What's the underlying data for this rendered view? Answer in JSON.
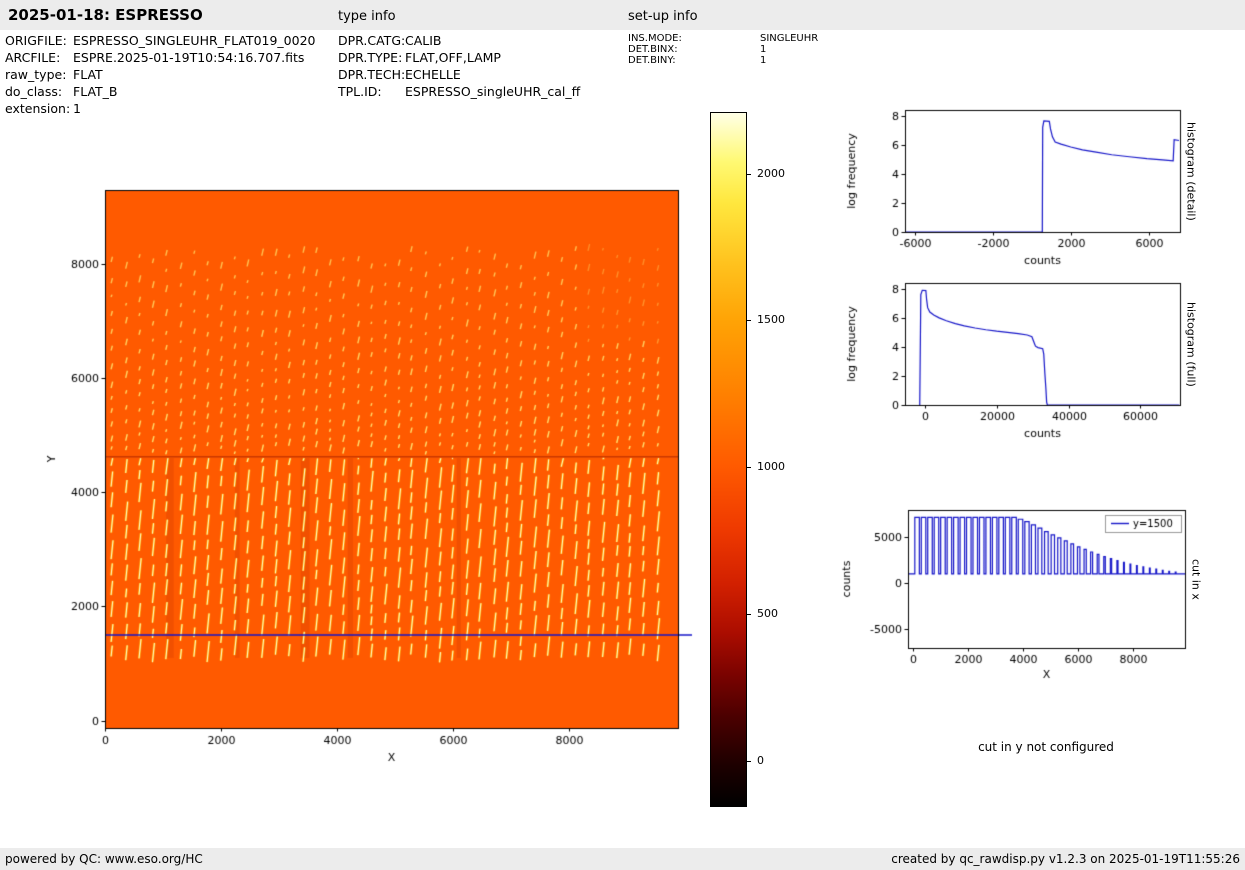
{
  "header": {
    "title": "2025-01-18: ESPRESSO",
    "type_info_label": "type info",
    "setup_info_label": "set-up info"
  },
  "metadata": {
    "left": [
      {
        "label": "ORIGFILE:",
        "value": "ESPRESSO_SINGLEUHR_FLAT019_0020"
      },
      {
        "label": "ARCFILE:",
        "value": "ESPRE.2025-01-19T10:54:16.707.fits"
      },
      {
        "label": "raw_type:",
        "value": "FLAT"
      },
      {
        "label": "do_class:",
        "value": "FLAT_B"
      },
      {
        "label": "extension:",
        "value": "1"
      }
    ],
    "type": [
      {
        "label": "DPR.CATG:",
        "value": "CALIB"
      },
      {
        "label": "DPR.TYPE:",
        "value": "FLAT,OFF,LAMP"
      },
      {
        "label": "DPR.TECH:",
        "value": "ECHELLE"
      },
      {
        "label": "TPL.ID:",
        "value": "ESPRESSO_singleUHR_cal_ff"
      }
    ],
    "setup": [
      {
        "label": "INS.MODE:",
        "value": "SINGLEUHR"
      },
      {
        "label": "DET.BINX:",
        "value": "1"
      },
      {
        "label": "DET.BINY:",
        "value": "1"
      }
    ]
  },
  "colors": {
    "accent_blue": "#1414c8",
    "header_bg": "#ececec",
    "image_base": "#ff5a00"
  },
  "colorbar": {
    "vmin": -150,
    "vmax": 2210,
    "tick_values": [
      2000,
      1500,
      1000,
      500,
      0
    ],
    "stops": [
      {
        "p": 0,
        "c": "#ffffe6"
      },
      {
        "p": 7,
        "c": "#fff973"
      },
      {
        "p": 13,
        "c": "#ffe73e"
      },
      {
        "p": 22,
        "c": "#ffc11d"
      },
      {
        "p": 30,
        "c": "#ffa305"
      },
      {
        "p": 41,
        "c": "#ff7f00"
      },
      {
        "p": 51,
        "c": "#ff5a00"
      },
      {
        "p": 60,
        "c": "#ef3a00"
      },
      {
        "p": 68,
        "c": "#d22000"
      },
      {
        "p": 75,
        "c": "#ab0d00"
      },
      {
        "p": 81,
        "c": "#7b0300"
      },
      {
        "p": 87,
        "c": "#4c0000"
      },
      {
        "p": 94,
        "c": "#1e0000"
      },
      {
        "p": 100,
        "c": "#000000"
      }
    ]
  },
  "chart_data": [
    {
      "id": "raw_image",
      "type": "heatmap",
      "xlabel": "X",
      "ylabel": "Y",
      "xlim": [
        0,
        9880
      ],
      "ylim": [
        -130,
        9300
      ],
      "xticks": [
        0,
        2000,
        4000,
        6000,
        8000
      ],
      "yticks": [
        0,
        2000,
        4000,
        6000,
        8000
      ],
      "background_counts": 1000,
      "cut_line_y": 1500,
      "orders": {
        "n_columns": 41,
        "x_start": 115,
        "spacing": 235,
        "bright_y_range": [
          1020,
          4600
        ],
        "faint_y_range": [
          4660,
          8260
        ],
        "gap_y": 4625
      },
      "dark_bands": [
        {
          "x": 1120,
          "w": 130
        },
        {
          "x": 2280,
          "w": 80
        },
        {
          "x": 3450,
          "w": 150
        },
        {
          "x": 4230,
          "w": 90
        },
        {
          "x": 6100,
          "w": 70
        }
      ]
    },
    {
      "id": "hist_detail",
      "type": "line",
      "xlabel": "counts",
      "ylabel": "log frequency",
      "right_label": "histogram (detail)",
      "xlim": [
        -6500,
        7600
      ],
      "ylim": [
        0,
        8.4
      ],
      "xticks": [
        -6000,
        -2000,
        2000,
        6000
      ],
      "yticks": [
        0,
        2,
        4,
        6,
        8
      ],
      "points": [
        [
          -6500,
          0
        ],
        [
          540,
          0
        ],
        [
          560,
          7.2
        ],
        [
          620,
          7.65
        ],
        [
          900,
          7.62
        ],
        [
          960,
          7.1
        ],
        [
          1060,
          6.55
        ],
        [
          1200,
          6.2
        ],
        [
          1500,
          6.05
        ],
        [
          2000,
          5.85
        ],
        [
          2600,
          5.65
        ],
        [
          3300,
          5.5
        ],
        [
          4100,
          5.32
        ],
        [
          5000,
          5.18
        ],
        [
          5900,
          5.05
        ],
        [
          6700,
          4.97
        ],
        [
          7250,
          4.9
        ],
        [
          7300,
          6.35
        ],
        [
          7550,
          6.3
        ]
      ]
    },
    {
      "id": "hist_full",
      "type": "line",
      "xlabel": "counts",
      "ylabel": "log frequency",
      "right_label": "histogram (full)",
      "xlim": [
        -5500,
        71000
      ],
      "ylim": [
        0,
        8.4
      ],
      "xticks": [
        0,
        20000,
        40000,
        60000
      ],
      "yticks": [
        0,
        2,
        4,
        6,
        8
      ],
      "points": [
        [
          -1400,
          0
        ],
        [
          -1100,
          7.6
        ],
        [
          -700,
          7.9
        ],
        [
          300,
          7.88
        ],
        [
          500,
          7.3
        ],
        [
          800,
          6.7
        ],
        [
          1400,
          6.4
        ],
        [
          2500,
          6.2
        ],
        [
          4000,
          6.0
        ],
        [
          6000,
          5.8
        ],
        [
          8500,
          5.6
        ],
        [
          11000,
          5.45
        ],
        [
          14000,
          5.3
        ],
        [
          17000,
          5.18
        ],
        [
          20000,
          5.08
        ],
        [
          23000,
          5.0
        ],
        [
          26000,
          4.92
        ],
        [
          28500,
          4.82
        ],
        [
          29800,
          4.7
        ],
        [
          30400,
          4.3
        ],
        [
          30800,
          4.05
        ],
        [
          31500,
          3.95
        ],
        [
          32800,
          3.88
        ],
        [
          33100,
          3.5
        ],
        [
          33400,
          2.2
        ],
        [
          33700,
          1.1
        ],
        [
          33900,
          0.2
        ],
        [
          34100,
          0
        ],
        [
          70800,
          0
        ]
      ]
    },
    {
      "id": "cut_x",
      "type": "line",
      "xlabel": "X",
      "ylabel": "counts",
      "right_label": "cut in x",
      "legend": "y=1500",
      "xlim": [
        -180,
        9890
      ],
      "ylim": [
        -7100,
        8000
      ],
      "xticks": [
        0,
        2000,
        4000,
        6000,
        8000
      ],
      "yticks": [
        -5000,
        0,
        5000
      ],
      "baseline": 1000,
      "comb": {
        "x_start": 150,
        "spacing": 235,
        "wide_duty": 0.7,
        "narrow_after": 3900,
        "min_duty": 0.12,
        "taper": 4600,
        "x_end": 9650
      },
      "envelope": [
        [
          0,
          7200
        ],
        [
          3700,
          7200
        ],
        [
          4100,
          6800
        ],
        [
          4500,
          6200
        ],
        [
          5000,
          5400
        ],
        [
          5500,
          4700
        ],
        [
          6000,
          4000
        ],
        [
          6500,
          3400
        ],
        [
          7000,
          2850
        ],
        [
          7500,
          2400
        ],
        [
          8000,
          2000
        ],
        [
          8500,
          1700
        ],
        [
          9000,
          1450
        ],
        [
          9400,
          1250
        ],
        [
          9800,
          1150
        ]
      ]
    }
  ],
  "notes": {
    "cut_y": "cut in y not configured"
  },
  "footer": {
    "left": "powered by QC: www.eso.org/HC",
    "right": "created by qc_rawdisp.py v1.2.3 on 2025-01-19T11:55:26"
  }
}
